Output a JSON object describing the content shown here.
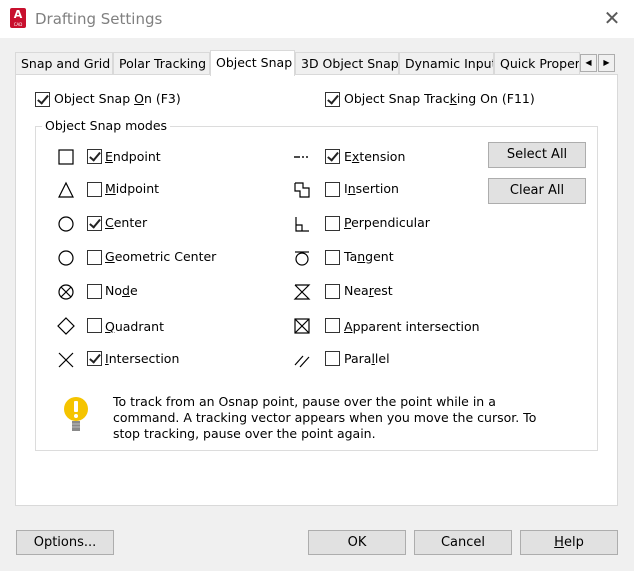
{
  "window": {
    "title": "Drafting Settings",
    "app_icon_letter": "A",
    "app_icon_sub": "CAD"
  },
  "tabs": [
    {
      "label": "Snap and Grid",
      "active": false
    },
    {
      "label": "Polar Tracking",
      "active": false
    },
    {
      "label": "Object Snap",
      "active": true
    },
    {
      "label": "3D Object Snap",
      "active": false
    },
    {
      "label": "Dynamic Input",
      "active": false
    },
    {
      "label": "Quick Propert",
      "active": false
    }
  ],
  "top_options": {
    "osnap_on": {
      "pre": "Object Snap ",
      "key": "O",
      "post": "n (F3)",
      "checked": true
    },
    "tracking_on": {
      "pre": "Object Snap Trac",
      "key": "k",
      "post": "ing On (F11)",
      "checked": true
    }
  },
  "modes_group": {
    "title": "Object Snap modes"
  },
  "modes_left": [
    {
      "key": "E",
      "rest": "ndpoint",
      "checked": true,
      "marker": "square-marker-icon"
    },
    {
      "key": "M",
      "rest": "idpoint",
      "checked": false,
      "marker": "triangle-marker-icon"
    },
    {
      "key": "C",
      "rest": "enter",
      "checked": true,
      "marker": "circle-marker-icon"
    },
    {
      "key": "G",
      "rest": "eometric Center",
      "checked": false,
      "marker": "circle-marker-icon"
    },
    {
      "key": "N",
      "rest": "ode",
      "pre": "No",
      "checked": false,
      "marker": "node-marker-icon"
    },
    {
      "key": "Q",
      "rest": "uadrant",
      "checked": false,
      "marker": "diamond-marker-icon"
    },
    {
      "key": "I",
      "rest": "ntersection",
      "checked": true,
      "marker": "x-marker-icon"
    }
  ],
  "modes_right": [
    {
      "key": "X",
      "pre": "E",
      "rest": "tension",
      "checked": true,
      "marker": "extension-marker-icon"
    },
    {
      "key": "n",
      "pre": "I",
      "rest": "sertion",
      "checked": false,
      "marker": "insertion-marker-icon"
    },
    {
      "key": "P",
      "pre": "",
      "rest": "erpendicular",
      "checked": false,
      "marker": "perpendicular-marker-icon"
    },
    {
      "key": "n",
      "pre": "Ta",
      "rest": "gent",
      "checked": false,
      "marker": "tangent-marker-icon"
    },
    {
      "key": "r",
      "pre": "Nea",
      "rest": "est",
      "checked": false,
      "marker": "nearest-marker-icon"
    },
    {
      "key": "A",
      "pre": "",
      "rest": "pparent intersection",
      "checked": false,
      "marker": "apparent-intersection-marker-icon"
    },
    {
      "key": "l",
      "pre": "Para",
      "rest": "lel",
      "checked": false,
      "marker": "parallel-marker-icon"
    }
  ],
  "side_buttons": {
    "select_all": "Select All",
    "clear_all": "Clear All"
  },
  "hint_text": "To track from an Osnap point, pause over the point while in a command.  A tracking vector appears when you move the cursor.  To stop tracking, pause over the point again.",
  "footer": {
    "options": "Options...",
    "ok": "OK",
    "cancel": "Cancel",
    "help_key": "H",
    "help_rest": "elp"
  },
  "colors": {
    "accent_red": "#c8102e",
    "bulb_yellow": "#f5c400"
  }
}
